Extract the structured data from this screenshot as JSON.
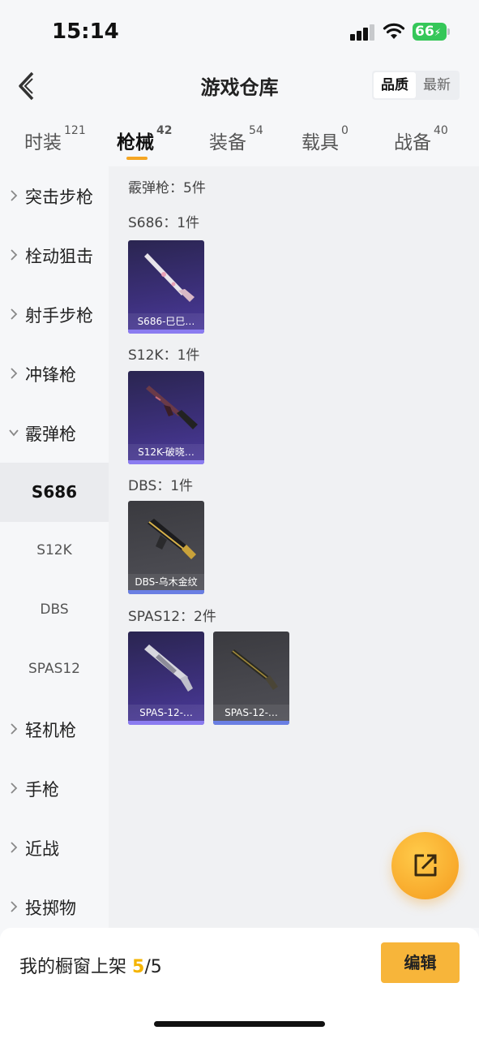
{
  "status_bar": {
    "time": "15:14",
    "battery": "66"
  },
  "header": {
    "title": "游戏仓库",
    "sort_options": [
      "品质",
      "最新"
    ]
  },
  "tabs": [
    {
      "label": "时装",
      "count": "121"
    },
    {
      "label": "枪械",
      "count": "42"
    },
    {
      "label": "装备",
      "count": "54"
    },
    {
      "label": "载具",
      "count": "0"
    },
    {
      "label": "战备",
      "count": "40"
    }
  ],
  "sidebar": [
    {
      "label": "突击步枪",
      "type": "category"
    },
    {
      "label": "栓动狙击",
      "type": "category"
    },
    {
      "label": "射手步枪",
      "type": "category"
    },
    {
      "label": "冲锋枪",
      "type": "category"
    },
    {
      "label": "霰弹枪",
      "type": "category-expanded"
    },
    {
      "label": "S686",
      "type": "sub-selected"
    },
    {
      "label": "S12K",
      "type": "sub"
    },
    {
      "label": "DBS",
      "type": "sub"
    },
    {
      "label": "SPAS12",
      "type": "sub"
    },
    {
      "label": "轻机枪",
      "type": "category"
    },
    {
      "label": "手枪",
      "type": "category"
    },
    {
      "label": "近战",
      "type": "category"
    },
    {
      "label": "投掷物",
      "type": "category"
    }
  ],
  "main": {
    "summary": "霰弹枪：5件",
    "sections": [
      {
        "title": "S686：1件",
        "items": [
          {
            "name": "S686-巳巳…",
            "rarity": "purple"
          }
        ]
      },
      {
        "title": "S12K：1件",
        "items": [
          {
            "name": "S12K-破晓…",
            "rarity": "purple"
          }
        ]
      },
      {
        "title": "DBS：1件",
        "items": [
          {
            "name": "DBS-乌木金纹",
            "rarity": "grey"
          }
        ]
      },
      {
        "title": "SPAS12：2件",
        "items": [
          {
            "name": "SPAS-12-…",
            "rarity": "purple"
          },
          {
            "name": "SPAS-12-…",
            "rarity": "grey"
          }
        ]
      }
    ]
  },
  "bottom_bar": {
    "showcase_label": "我的橱窗上架",
    "showcase_count": "5",
    "showcase_total": "/5",
    "edit_label": "编辑"
  },
  "colors": {
    "accent": "#f5a623",
    "edit_button": "#f7b53a",
    "rarity_purple": "#3b2f78",
    "rarity_grey": "#48484e"
  }
}
